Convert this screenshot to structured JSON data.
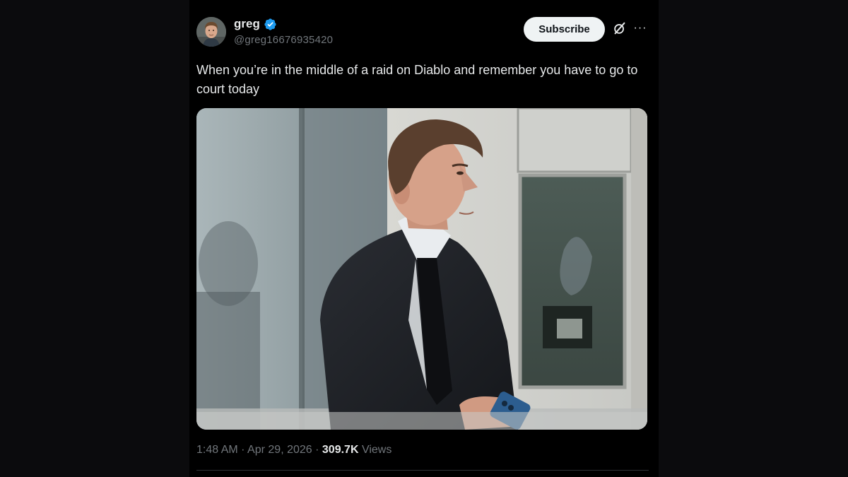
{
  "author": {
    "display_name": "greg",
    "handle": "@greg16676935420",
    "verified": true
  },
  "actions": {
    "subscribe_label": "Subscribe",
    "grok_icon": "grok-icon",
    "more_icon": "more-icon"
  },
  "tweet": {
    "text": "When you’re in the middle of a raid on Diablo and remember you have to go to court today",
    "media_icon": "photo"
  },
  "meta": {
    "time": "1:48 AM",
    "separator": "·",
    "date": "Apr 29, 2026",
    "views_count": "309.7K",
    "views_label": "Views"
  },
  "colors": {
    "background": "#000000",
    "text_primary": "#e7e9ea",
    "text_secondary": "#71767b",
    "verified_blue": "#1d9bf0",
    "button_bg": "#eff3f4"
  }
}
